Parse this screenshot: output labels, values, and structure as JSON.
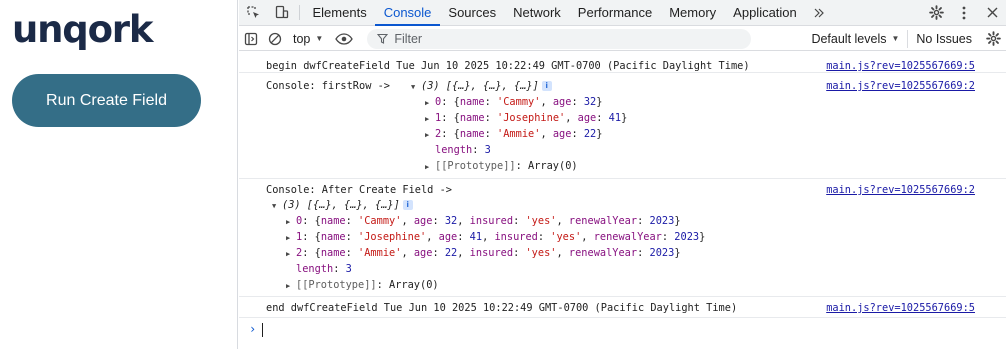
{
  "app": {
    "logo": "unqork",
    "run_button": "Run Create Field"
  },
  "devtools": {
    "tabs": [
      "Elements",
      "Console",
      "Sources",
      "Network",
      "Performance",
      "Memory",
      "Application"
    ],
    "active_tab": "Console",
    "toolbar": {
      "context": "top",
      "filter_placeholder": "Filter",
      "levels": "Default levels",
      "issues": "No Issues"
    },
    "console": {
      "msg1": {
        "text": "begin dwfCreateField Tue Jun 10 2025 10:22:49 GMT-0700 (Pacific Daylight Time)",
        "source": "main.js?rev=1025567669:5"
      },
      "msg2": {
        "prefix": "Console: firstRow ->",
        "summary": "(3) [{…}, {…}, {…}]",
        "source": "main.js?rev=1025567669:2",
        "items": [
          {
            "index": "0",
            "name": "'Cammy'",
            "age": "32"
          },
          {
            "index": "1",
            "name": "'Josephine'",
            "age": "41"
          },
          {
            "index": "2",
            "name": "'Ammie'",
            "age": "22"
          }
        ],
        "length_key": "length",
        "length_val": "3",
        "proto_key": "[[Prototype]]",
        "proto_val": "Array(0)"
      },
      "msg3": {
        "prefix": "Console: After Create Field ->",
        "summary": "(3) [{…}, {…}, {…}]",
        "source": "main.js?rev=1025567669:2",
        "items": [
          {
            "index": "0",
            "name": "'Cammy'",
            "age": "32",
            "insured": "'yes'",
            "renewalYear": "2023"
          },
          {
            "index": "1",
            "name": "'Josephine'",
            "age": "41",
            "insured": "'yes'",
            "renewalYear": "2023"
          },
          {
            "index": "2",
            "name": "'Ammie'",
            "age": "22",
            "insured": "'yes'",
            "renewalYear": "2023"
          }
        ],
        "length_key": "length",
        "length_val": "3",
        "proto_key": "[[Prototype]]",
        "proto_val": "Array(0)"
      },
      "msg4": {
        "text": "end dwfCreateField Tue Jun 10 2025 10:22:49 GMT-0700 (Pacific Daylight Time)",
        "source": "main.js?rev=1025567669:5"
      }
    }
  }
}
